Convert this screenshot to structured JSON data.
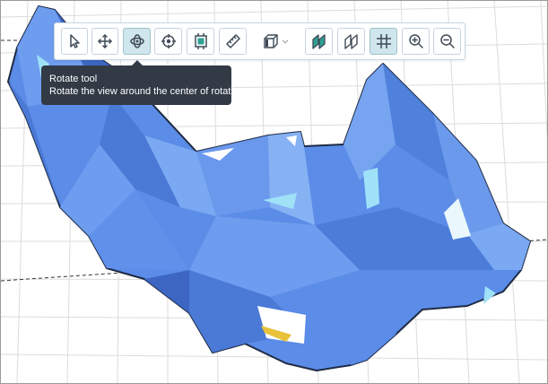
{
  "tooltip": {
    "title": "Rotate tool",
    "description": "Rotate the view around the center of rotation."
  },
  "toolbar": {
    "tools": [
      {
        "name": "select-tool",
        "icon": "cursor-arrow-icon",
        "active": false
      },
      {
        "name": "pan-tool",
        "icon": "move-arrows-icon",
        "active": false
      },
      {
        "name": "rotate-tool",
        "icon": "rotate-orbit-icon",
        "active": true
      },
      {
        "name": "center-of-rotation-tool",
        "icon": "crosshair-target-icon",
        "active": false
      },
      {
        "name": "fit-to-view-tool",
        "icon": "frame-square-icon",
        "active": false
      },
      {
        "name": "measure-tool",
        "icon": "ruler-icon",
        "active": false
      },
      {
        "name": "view-cube-menu",
        "icon": "cube-icon",
        "active": false
      },
      {
        "name": "shaded-view-tool",
        "icon": "shaded-planes-icon",
        "active": false
      },
      {
        "name": "wireframe-view-tool",
        "icon": "outline-planes-icon",
        "active": false
      },
      {
        "name": "grid-toggle-tool",
        "icon": "grid-icon",
        "active": true
      },
      {
        "name": "zoom-in-tool",
        "icon": "zoom-in-icon",
        "active": false
      },
      {
        "name": "zoom-out-tool",
        "icon": "zoom-out-icon",
        "active": false
      }
    ]
  },
  "colors": {
    "model_fill": "#5b8ce8",
    "model_dark": "#3c66c2",
    "model_light": "#86b2f4",
    "highlight": "#9fe2f8",
    "grid_line": "#dcdcdc",
    "toolbar_accent": "#2f9f92",
    "tooltip_bg": "#313a45"
  }
}
